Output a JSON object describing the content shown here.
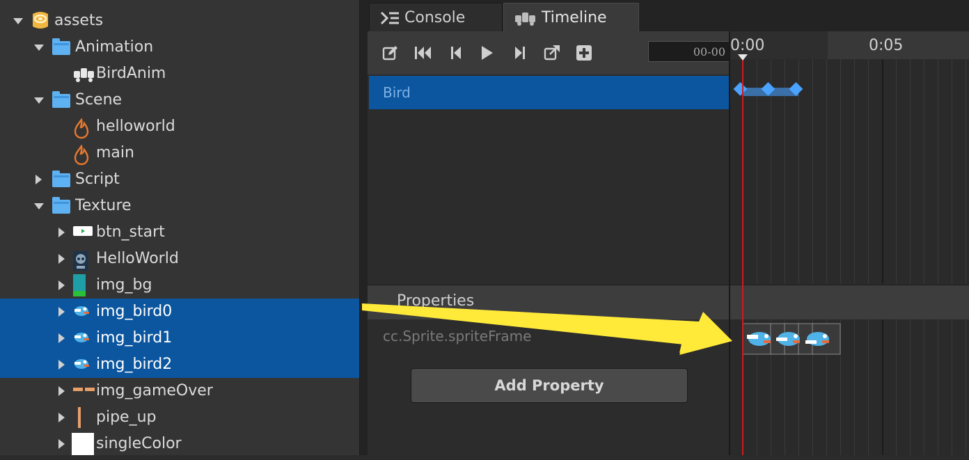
{
  "assets": {
    "items": [
      {
        "label": "assets",
        "icon": "database-icon",
        "expanded": true,
        "selected": false
      },
      {
        "label": "Animation",
        "icon": "folder-icon",
        "expanded": true,
        "selected": false
      },
      {
        "label": "BirdAnim",
        "icon": "animation-clip-icon",
        "expanded": null,
        "selected": false
      },
      {
        "label": "Scene",
        "icon": "folder-icon",
        "expanded": true,
        "selected": false
      },
      {
        "label": "helloworld",
        "icon": "scene-fire-icon",
        "expanded": null,
        "selected": false
      },
      {
        "label": "main",
        "icon": "scene-fire-icon",
        "expanded": null,
        "selected": false
      },
      {
        "label": "Script",
        "icon": "folder-icon",
        "expanded": false,
        "selected": false
      },
      {
        "label": "Texture",
        "icon": "folder-icon",
        "expanded": true,
        "selected": false
      },
      {
        "label": "btn_start",
        "icon": "texture-btn-start-icon",
        "expanded": false,
        "selected": false
      },
      {
        "label": "HelloWorld",
        "icon": "texture-helloworld-icon",
        "expanded": false,
        "selected": false
      },
      {
        "label": "img_bg",
        "icon": "texture-bg-icon",
        "expanded": false,
        "selected": false
      },
      {
        "label": "img_bird0",
        "icon": "texture-bird-icon",
        "expanded": false,
        "selected": true
      },
      {
        "label": "img_bird1",
        "icon": "texture-bird-icon",
        "expanded": false,
        "selected": true
      },
      {
        "label": "img_bird2",
        "icon": "texture-bird-icon",
        "expanded": false,
        "selected": true
      },
      {
        "label": "img_gameOver",
        "icon": "texture-gameover-icon",
        "expanded": false,
        "selected": false
      },
      {
        "label": "pipe_up",
        "icon": "texture-pipe-icon",
        "expanded": false,
        "selected": false
      },
      {
        "label": "singleColor",
        "icon": "texture-white-icon",
        "expanded": false,
        "selected": false
      }
    ]
  },
  "tabs": {
    "console": "Console",
    "timeline": "Timeline"
  },
  "toolbar": {
    "time_display": "00-00"
  },
  "ruler": {
    "label_start": "0:00",
    "label_mid": "0:05"
  },
  "nodes": {
    "bird": "Bird"
  },
  "properties": {
    "title": "Properties",
    "sprite_frame": "cc.Sprite.spriteFrame",
    "add_button": "Add Property"
  },
  "colors": {
    "selection": "#0b569f",
    "keyframe": "#4aa3ff",
    "playhead": "#d21a1a",
    "arrow": "#ffeb3b"
  }
}
